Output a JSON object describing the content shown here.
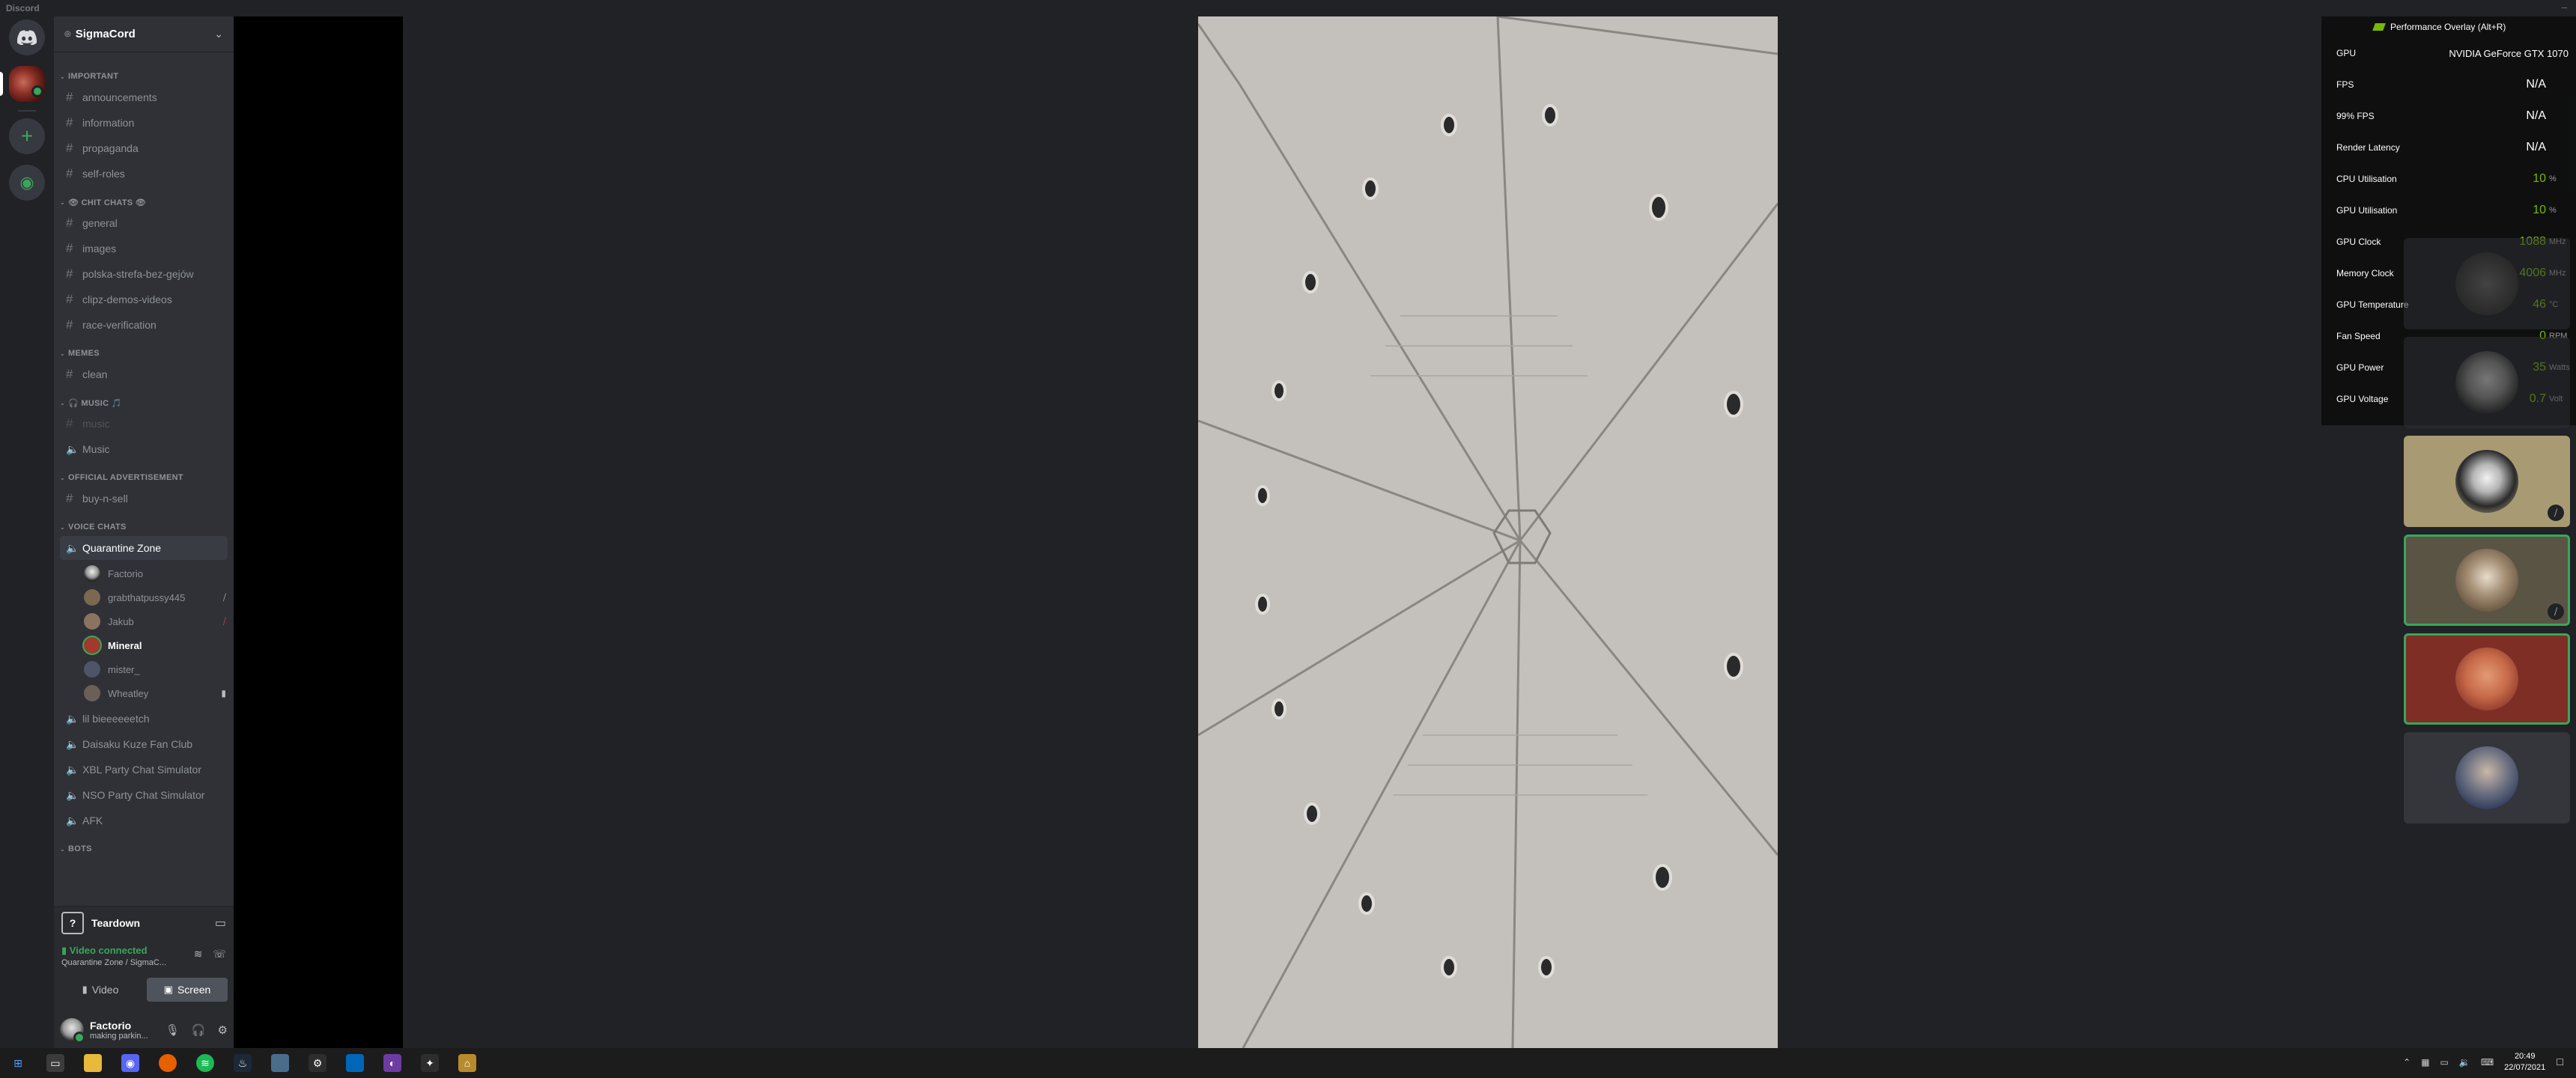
{
  "window": {
    "title": "Discord"
  },
  "rail": {
    "home_icon": "discord-logo-icon",
    "add_icon": "+",
    "explore_icon": "compass-icon"
  },
  "guild": {
    "name": "SigmaCord",
    "chevron": "⌄"
  },
  "categories": {
    "important": "IMPORTANT",
    "chit_chats": "👁 CHIT CHATS 👁",
    "memes": "MEMES",
    "music": "🎧 MUSIC 🎵",
    "ads": "OFFICIAL ADVERTISEMENT",
    "voice": "VOICE CHATS",
    "bots": "BOTS"
  },
  "channels": {
    "important": [
      "announcements",
      "information",
      "propaganda",
      "self-roles"
    ],
    "chit_chats": [
      "general",
      "images",
      "polska-strefa-bez-gejów",
      "clipz-demos-videos",
      "race-verification"
    ],
    "memes": [
      "clean"
    ],
    "music_text": "music",
    "music_voice": "Music",
    "ads": [
      "buy-n-sell"
    ],
    "voice_active": "Quarantine Zone",
    "voice_others": [
      "lil bieeeeeetch",
      "Daisaku Kuze Fan Club",
      "XBL Party Chat Simulator",
      "NSO Party Chat Simulator",
      "AFK"
    ]
  },
  "voice_users": [
    {
      "name": "Factorio",
      "icon": ""
    },
    {
      "name": "grabthatpussy445",
      "icon": "mic-muted-icon"
    },
    {
      "name": "Jakub",
      "icon": "mic-muted-icon"
    },
    {
      "name": "Mineral",
      "icon": ""
    },
    {
      "name": "mister_",
      "icon": ""
    },
    {
      "name": "Wheatley",
      "icon": "video-icon"
    }
  ],
  "stream_panel": {
    "game": "Teardown",
    "badge": "?"
  },
  "voice_panel": {
    "status": "Video connected",
    "location": "Quarantine Zone / SigmaC...",
    "video_label": "Video",
    "screen_label": "Screen"
  },
  "user_panel": {
    "name": "Factorio",
    "status": "making parkin..."
  },
  "perf_overlay": {
    "title": "Performance Overlay (Alt+R)",
    "rows": [
      {
        "label": "GPU",
        "value": "NVIDIA GeForce GTX 1070",
        "unit": ""
      },
      {
        "label": "FPS",
        "value": "N/A",
        "unit": ""
      },
      {
        "label": "99% FPS",
        "value": "N/A",
        "unit": ""
      },
      {
        "label": "Render Latency",
        "value": "N/A",
        "unit": ""
      },
      {
        "label": "CPU Utilisation",
        "value": "10",
        "unit": "%"
      },
      {
        "label": "GPU Utilisation",
        "value": "10",
        "unit": "%"
      },
      {
        "label": "GPU Clock",
        "value": "1088",
        "unit": "MHz"
      },
      {
        "label": "Memory Clock",
        "value": "4006",
        "unit": "MHz"
      },
      {
        "label": "GPU Temperature",
        "value": "46",
        "unit": "°C"
      },
      {
        "label": "Fan Speed",
        "value": "0",
        "unit": "RPM"
      },
      {
        "label": "GPU Power",
        "value": "35",
        "unit": "Watts"
      },
      {
        "label": "GPU Voltage",
        "value": "0.7",
        "unit": "Volt"
      }
    ]
  },
  "taskbar": {
    "time": "20:49",
    "date": "22/07/2021"
  },
  "colors": {
    "online": "#3ba55c",
    "nvidia": "#76b900",
    "danger": "#ed4245"
  }
}
